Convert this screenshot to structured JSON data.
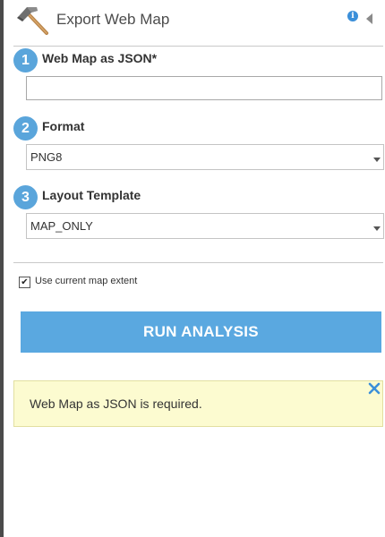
{
  "header": {
    "title": "Export Web Map",
    "icon": "hammer-icon",
    "info_icon_glyph": "i"
  },
  "steps": [
    {
      "number": "1",
      "label": "Web Map as JSON*"
    },
    {
      "number": "2",
      "label": "Format"
    },
    {
      "number": "3",
      "label": "Layout Template"
    }
  ],
  "web_map_input": {
    "value": ""
  },
  "format_select": {
    "selected": "PNG8"
  },
  "layout_select": {
    "selected": "MAP_ONLY"
  },
  "extent_option": {
    "label": "Use current map extent",
    "checked": true,
    "check_glyph": "✔"
  },
  "run_button": {
    "label": "RUN ANALYSIS"
  },
  "message": {
    "text": "Web Map as JSON is required."
  },
  "colors": {
    "accent": "#5aa8e0",
    "step_badge": "#5aa5db",
    "message_bg": "#fcfbd0",
    "close_icon": "#3b8fd9"
  }
}
